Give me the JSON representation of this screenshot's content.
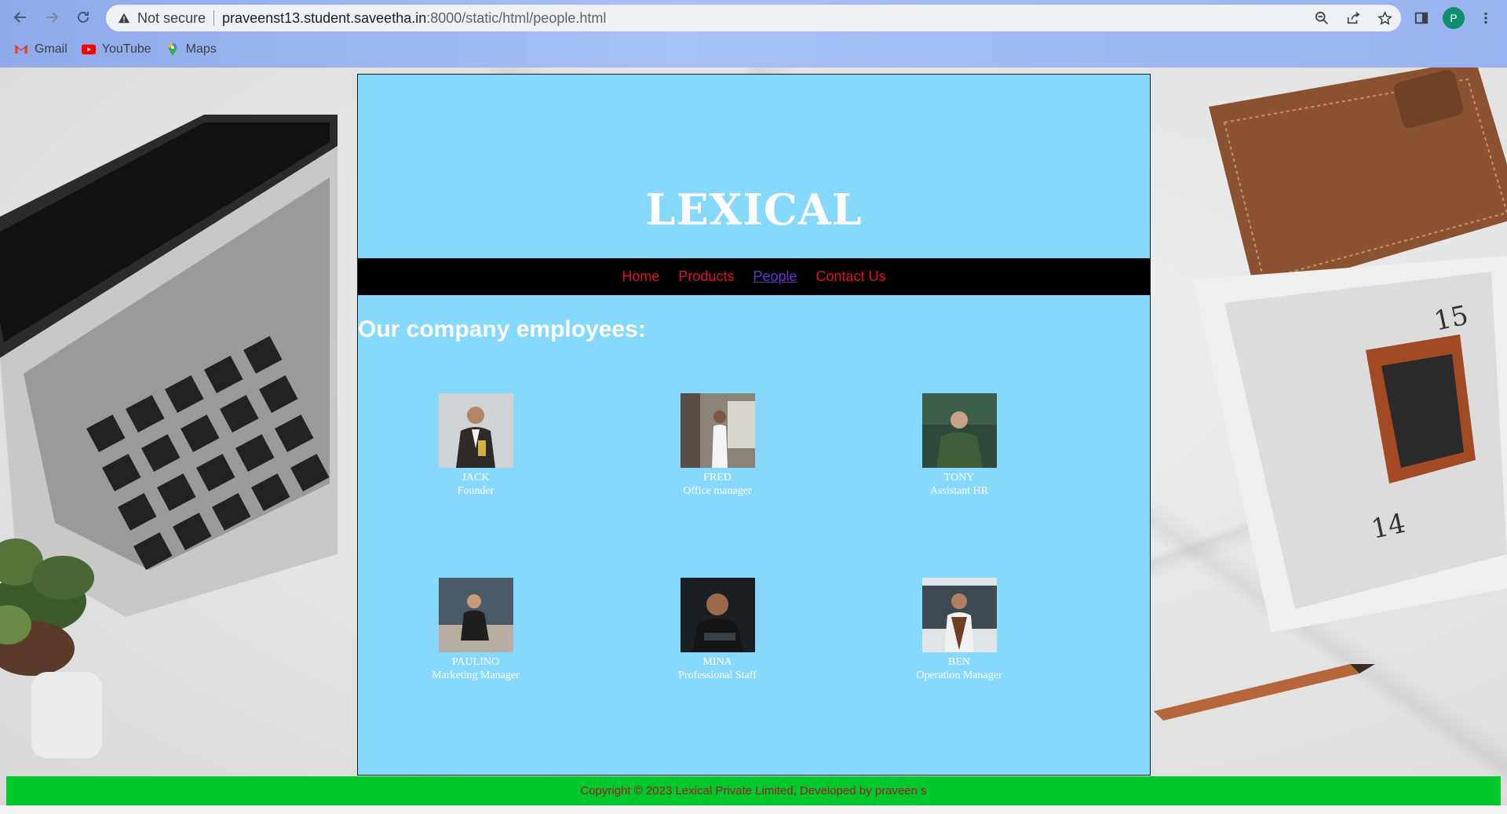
{
  "browser": {
    "security_label": "Not secure",
    "url_host": "praveenst13.student.saveetha.in",
    "url_path": ":8000/static/html/people.html",
    "profile_initial": "P",
    "bookmarks": [
      {
        "label": "Gmail",
        "icon": "gmail-icon"
      },
      {
        "label": "YouTube",
        "icon": "youtube-icon"
      },
      {
        "label": "Maps",
        "icon": "maps-icon"
      }
    ]
  },
  "site": {
    "brand": "LEXICAL",
    "nav": [
      {
        "label": "Home",
        "active": false
      },
      {
        "label": "Products",
        "active": false
      },
      {
        "label": "People",
        "active": true
      },
      {
        "label": "Contact Us",
        "active": false
      }
    ],
    "section_title": "Our company employees:",
    "employees": [
      {
        "name": "JACK",
        "role": "Founder"
      },
      {
        "name": "FRED",
        "role": "Office manager"
      },
      {
        "name": "TONY",
        "role": "Assistant HR"
      },
      {
        "name": "PAULINO",
        "role": "Marketing Manager"
      },
      {
        "name": "MINA",
        "role": "Professional Staff"
      },
      {
        "name": "BEN",
        "role": "Operation Manager"
      }
    ],
    "footer": "Copyright © 2023 Lexical Private Limited, Developed by praveen s"
  },
  "colors": {
    "site_bg": "#87d8fd",
    "nav_link": "#e0112b",
    "nav_active": "#6a31c9",
    "footer_bg": "#00c72c",
    "footer_text": "#a31a22"
  }
}
